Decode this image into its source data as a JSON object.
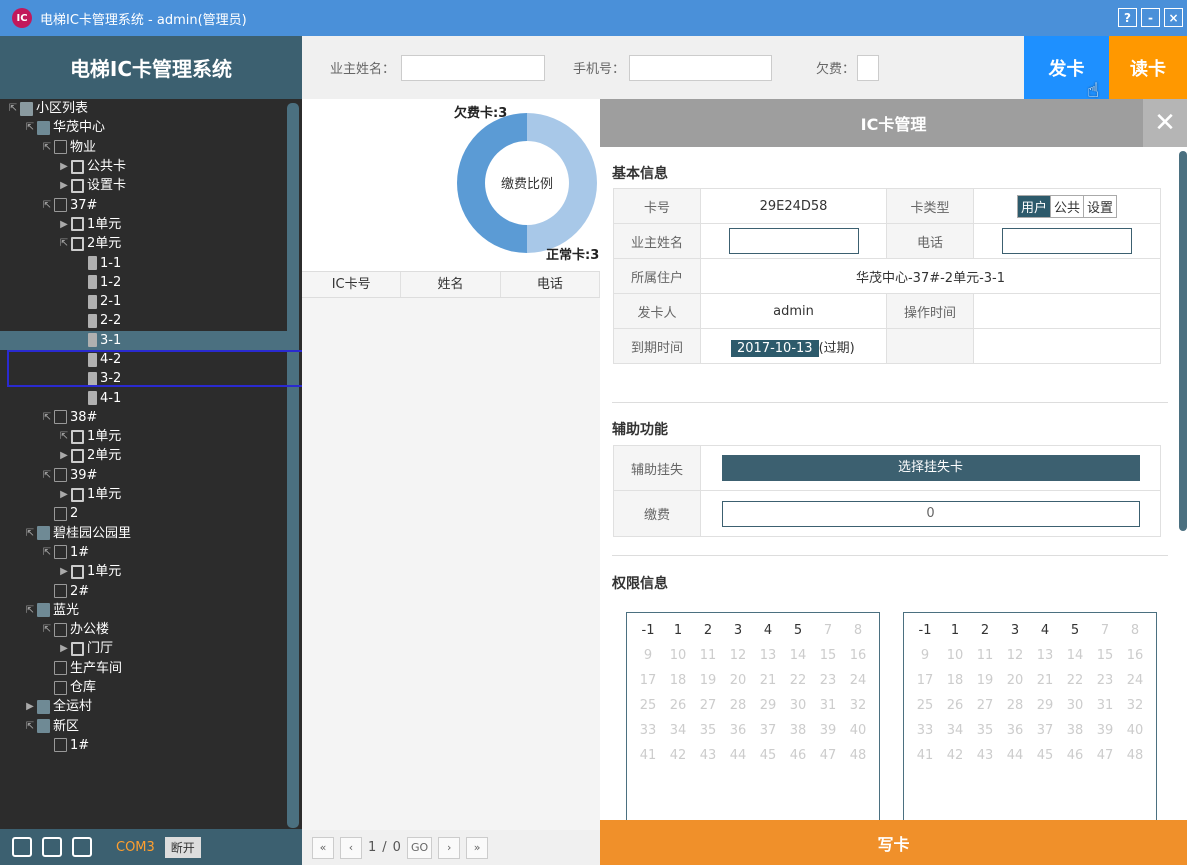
{
  "window": {
    "title": "电梯IC卡管理系统 - admin(管理员)",
    "buttons": [
      "?",
      "-",
      "×"
    ]
  },
  "sidebar": {
    "title": "电梯IC卡管理系统",
    "footer": {
      "port": "COM3",
      "disconnect": "断开"
    },
    "tree": [
      {
        "label": "小区列表",
        "level": 0,
        "tw": "⇱",
        "icon": "list"
      },
      {
        "label": "华茂中心",
        "level": 1,
        "tw": "⇱",
        "icon": "bldg"
      },
      {
        "label": "物业",
        "level": 2,
        "tw": "⇱",
        "icon": "floor"
      },
      {
        "label": "公共卡",
        "level": 3,
        "tw": "▶",
        "icon": "unit"
      },
      {
        "label": "设置卡",
        "level": 3,
        "tw": "▶",
        "icon": "unit"
      },
      {
        "label": "37#",
        "level": 2,
        "tw": "⇱",
        "icon": "floor"
      },
      {
        "label": "1单元",
        "level": 3,
        "tw": "▶",
        "icon": "unit"
      },
      {
        "label": "2单元",
        "level": 3,
        "tw": "⇱",
        "icon": "unit"
      },
      {
        "label": "1-1",
        "level": 4,
        "tw": "",
        "icon": "door"
      },
      {
        "label": "1-2",
        "level": 4,
        "tw": "",
        "icon": "door"
      },
      {
        "label": "2-1",
        "level": 4,
        "tw": "",
        "icon": "door"
      },
      {
        "label": "2-2",
        "level": 4,
        "tw": "",
        "icon": "door"
      },
      {
        "label": "3-1",
        "level": 4,
        "tw": "",
        "icon": "door",
        "sel": true
      },
      {
        "label": "4-2",
        "level": 4,
        "tw": "",
        "icon": "door"
      },
      {
        "label": "3-2",
        "level": 4,
        "tw": "",
        "icon": "door"
      },
      {
        "label": "4-1",
        "level": 4,
        "tw": "",
        "icon": "door"
      },
      {
        "label": "38#",
        "level": 2,
        "tw": "⇱",
        "icon": "floor"
      },
      {
        "label": "1单元",
        "level": 3,
        "tw": "⇱",
        "icon": "unit"
      },
      {
        "label": "2单元",
        "level": 3,
        "tw": "▶",
        "icon": "unit"
      },
      {
        "label": "39#",
        "level": 2,
        "tw": "⇱",
        "icon": "floor"
      },
      {
        "label": "1单元",
        "level": 3,
        "tw": "▶",
        "icon": "unit"
      },
      {
        "label": "2",
        "level": 2,
        "tw": "",
        "icon": "floor"
      },
      {
        "label": "碧桂园公园里",
        "level": 1,
        "tw": "⇱",
        "icon": "bldg"
      },
      {
        "label": "1#",
        "level": 2,
        "tw": "⇱",
        "icon": "floor"
      },
      {
        "label": "1单元",
        "level": 3,
        "tw": "▶",
        "icon": "unit"
      },
      {
        "label": "2#",
        "level": 2,
        "tw": "",
        "icon": "floor"
      },
      {
        "label": "蓝光",
        "level": 1,
        "tw": "⇱",
        "icon": "bldg"
      },
      {
        "label": "办公楼",
        "level": 2,
        "tw": "⇱",
        "icon": "floor"
      },
      {
        "label": "门厅",
        "level": 3,
        "tw": "▶",
        "icon": "unit"
      },
      {
        "label": "生产车间",
        "level": 2,
        "tw": "",
        "icon": "floor"
      },
      {
        "label": "仓库",
        "level": 2,
        "tw": "",
        "icon": "floor"
      },
      {
        "label": "全运村",
        "level": 1,
        "tw": "▶",
        "icon": "bldg"
      },
      {
        "label": "新区",
        "level": 1,
        "tw": "⇱",
        "icon": "bldg"
      },
      {
        "label": "1#",
        "level": 2,
        "tw": "",
        "icon": "floor"
      }
    ]
  },
  "search": {
    "owner_label": "业主姓名：",
    "phone_label": "手机号：",
    "debt_label": "欠费："
  },
  "actions": {
    "issue": "发卡",
    "read": "读卡"
  },
  "chart_data": {
    "type": "pie",
    "title": "缴费比例",
    "labels": [
      "欠费卡:3",
      "正常卡:3"
    ],
    "values": [
      3,
      3
    ],
    "colors": [
      "#a8c8e8",
      "#5b9bd5"
    ]
  },
  "list": {
    "columns": [
      "IC卡号",
      "姓名",
      "电话"
    ]
  },
  "pager": {
    "first": "«",
    "prev": "‹",
    "page": "1",
    "sep": "/",
    "total": "0",
    "go": "GO",
    "next": "›",
    "last": "»"
  },
  "panel": {
    "title": "IC卡管理",
    "close": "✕",
    "basic": {
      "title": "基本信息",
      "card_no_label": "卡号",
      "card_no": "29E24D58",
      "type_label": "卡类型",
      "types": [
        "用户",
        "公共",
        "设置"
      ],
      "owner_label": "业主姓名",
      "phone_label": "电话",
      "resident_label": "所属住户",
      "resident": "华茂中心-37#-2单元-3-1",
      "issuer_label": "发卡人",
      "issuer": "admin",
      "optime_label": "操作时间",
      "optime": "",
      "expiry_label": "到期时间",
      "expiry": "2017-10-13",
      "expiry_note": "(过期)"
    },
    "aux": {
      "title": "辅助功能",
      "lost_label": "辅助挂失",
      "lost_btn": "选择挂失卡",
      "fee_label": "缴费",
      "fee_value": "0"
    },
    "perm": {
      "title": "权限信息",
      "enabled": [
        "-1",
        "1",
        "2",
        "3",
        "4",
        "5"
      ],
      "floors": [
        "-1",
        "1",
        "2",
        "3",
        "4",
        "5",
        "7",
        "8",
        "9",
        "10",
        "11",
        "12",
        "13",
        "14",
        "15",
        "16",
        "17",
        "18",
        "19",
        "20",
        "21",
        "22",
        "23",
        "24",
        "25",
        "26",
        "27",
        "28",
        "29",
        "30",
        "31",
        "32",
        "33",
        "34",
        "35",
        "36",
        "37",
        "38",
        "39",
        "40",
        "41",
        "42",
        "43",
        "44",
        "45",
        "46",
        "47",
        "48"
      ]
    },
    "write": "写卡"
  }
}
